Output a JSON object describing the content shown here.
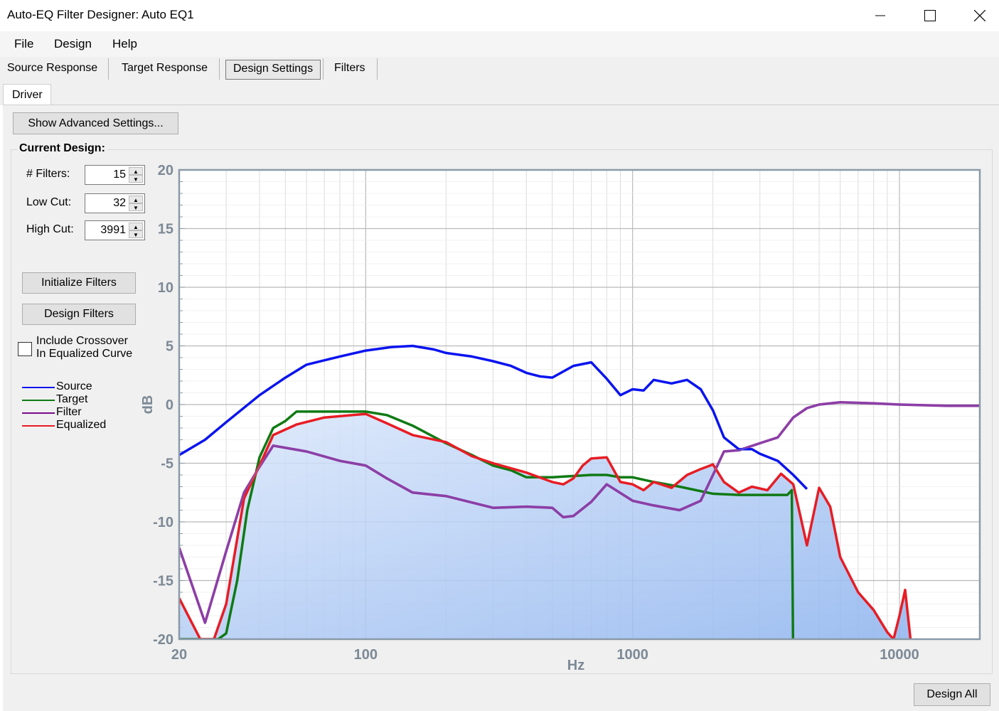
{
  "window": {
    "title": "Auto-EQ Filter Designer: Auto EQ1"
  },
  "menu": [
    "File",
    "Design",
    "Help"
  ],
  "toolbar": {
    "source_response": "Source Response",
    "target_response": "Target Response",
    "design_settings": "Design Settings",
    "filters": "Filters"
  },
  "tabs": {
    "driver": "Driver"
  },
  "buttons": {
    "advanced": "Show Advanced Settings...",
    "initialize": "Initialize Filters",
    "design_filters": "Design Filters",
    "design_all": "Design All"
  },
  "current_design": {
    "label": "Current Design:",
    "filters_label": "# Filters:",
    "filters_value": "15",
    "low_cut_label": "Low Cut:",
    "low_cut_value": "32",
    "high_cut_label": "High Cut:",
    "high_cut_value": "3991"
  },
  "include_crossover": {
    "line1": "Include Crossover",
    "line2": "In Equalized Curve",
    "checked": false
  },
  "colors": {
    "source": "#0a14ef",
    "target": "#0f7a14",
    "filter": "#7a0a8a",
    "equalized": "#e81c24",
    "fill": "#8db3ee",
    "filter_over_fill": "#9b6dc0",
    "target_over_fill": "#4e8a80"
  },
  "chart_data": {
    "type": "line",
    "x_scale": "log",
    "xlim": [
      20,
      20000
    ],
    "ylim": [
      -20,
      20
    ],
    "xlabel": "Hz",
    "ylabel": "dB",
    "x_ticks": [
      "20",
      "100",
      "1000",
      "10000"
    ],
    "y_ticks": [
      "20",
      "15",
      "10",
      "5",
      "0",
      "-5",
      "-10",
      "-15",
      "-20"
    ],
    "grid": true,
    "legend_position": "left-outside",
    "series": [
      {
        "name": "Source",
        "color": "#0a14ef",
        "points": [
          [
            20,
            -4.3
          ],
          [
            25,
            -3
          ],
          [
            30,
            -1.5
          ],
          [
            40,
            0.8
          ],
          [
            50,
            2.3
          ],
          [
            60,
            3.4
          ],
          [
            80,
            4.1
          ],
          [
            100,
            4.6
          ],
          [
            125,
            4.9
          ],
          [
            150,
            5
          ],
          [
            180,
            4.7
          ],
          [
            200,
            4.4
          ],
          [
            250,
            4.1
          ],
          [
            300,
            3.7
          ],
          [
            350,
            3.3
          ],
          [
            400,
            2.7
          ],
          [
            450,
            2.4
          ],
          [
            500,
            2.3
          ],
          [
            600,
            3.3
          ],
          [
            700,
            3.6
          ],
          [
            800,
            2.2
          ],
          [
            900,
            0.8
          ],
          [
            1000,
            1.3
          ],
          [
            1100,
            1.2
          ],
          [
            1200,
            2.1
          ],
          [
            1400,
            1.8
          ],
          [
            1600,
            2.1
          ],
          [
            1800,
            1.3
          ],
          [
            2000,
            -0.5
          ],
          [
            2200,
            -2.8
          ],
          [
            2500,
            -3.8
          ],
          [
            2800,
            -3.8
          ],
          [
            3000,
            -4.2
          ],
          [
            3500,
            -4.8
          ],
          [
            4000,
            -6
          ],
          [
            4500,
            -7.2
          ]
        ]
      },
      {
        "name": "Target",
        "color": "#0f7a14",
        "points": [
          [
            20,
            -20
          ],
          [
            28,
            -20
          ],
          [
            30,
            -19.5
          ],
          [
            33,
            -15
          ],
          [
            36,
            -9
          ],
          [
            40,
            -4.5
          ],
          [
            45,
            -2
          ],
          [
            50,
            -1.4
          ],
          [
            55,
            -0.6
          ],
          [
            70,
            -0.6
          ],
          [
            80,
            -0.6
          ],
          [
            100,
            -0.6
          ],
          [
            120,
            -0.9
          ],
          [
            150,
            -1.8
          ],
          [
            200,
            -3.3
          ],
          [
            250,
            -4.3
          ],
          [
            300,
            -5.2
          ],
          [
            350,
            -5.6
          ],
          [
            400,
            -6.2
          ],
          [
            500,
            -6.2
          ],
          [
            700,
            -6
          ],
          [
            800,
            -6
          ],
          [
            900,
            -6.2
          ],
          [
            1000,
            -6.2
          ],
          [
            1200,
            -6.6
          ],
          [
            1500,
            -7
          ],
          [
            2000,
            -7.6
          ],
          [
            2500,
            -7.7
          ],
          [
            3000,
            -7.7
          ],
          [
            3500,
            -7.7
          ],
          [
            3800,
            -7.7
          ],
          [
            3950,
            -7.3
          ],
          [
            3991,
            -20
          ]
        ]
      },
      {
        "name": "Filter",
        "color": "#7a0a8a",
        "points": [
          [
            20,
            -12.2
          ],
          [
            25,
            -18.6
          ],
          [
            30,
            -12.5
          ],
          [
            35,
            -7.5
          ],
          [
            40,
            -5.3
          ],
          [
            45,
            -3.5
          ],
          [
            60,
            -4
          ],
          [
            80,
            -4.8
          ],
          [
            100,
            -5.2
          ],
          [
            120,
            -6.3
          ],
          [
            150,
            -7.5
          ],
          [
            200,
            -7.8
          ],
          [
            300,
            -8.8
          ],
          [
            400,
            -8.7
          ],
          [
            500,
            -8.8
          ],
          [
            550,
            -9.6
          ],
          [
            600,
            -9.5
          ],
          [
            700,
            -8.3
          ],
          [
            800,
            -6.8
          ],
          [
            1000,
            -8.2
          ],
          [
            1200,
            -8.6
          ],
          [
            1500,
            -9
          ],
          [
            1800,
            -8.2
          ],
          [
            2000,
            -6
          ],
          [
            2200,
            -4
          ],
          [
            2500,
            -3.9
          ],
          [
            3000,
            -3.3
          ],
          [
            3500,
            -2.8
          ],
          [
            4000,
            -1.1
          ],
          [
            4500,
            -0.3
          ],
          [
            5000,
            0
          ],
          [
            6000,
            0.2
          ],
          [
            8000,
            0.1
          ],
          [
            10000,
            0
          ],
          [
            15000,
            -0.1
          ],
          [
            20000,
            -0.1
          ]
        ]
      },
      {
        "name": "Equalized",
        "color": "#e81c24",
        "points": [
          [
            20,
            -16.5
          ],
          [
            24,
            -20
          ],
          [
            27,
            -20
          ],
          [
            30,
            -17
          ],
          [
            35,
            -8
          ],
          [
            40,
            -5.2
          ],
          [
            45,
            -2.6
          ],
          [
            55,
            -1.7
          ],
          [
            70,
            -1.1
          ],
          [
            100,
            -0.8
          ],
          [
            120,
            -1.6
          ],
          [
            150,
            -2.6
          ],
          [
            200,
            -3.2
          ],
          [
            250,
            -4.4
          ],
          [
            300,
            -5
          ],
          [
            400,
            -5.8
          ],
          [
            500,
            -6.6
          ],
          [
            550,
            -6.8
          ],
          [
            600,
            -6.3
          ],
          [
            650,
            -5.2
          ],
          [
            700,
            -4.6
          ],
          [
            800,
            -4.5
          ],
          [
            900,
            -6.6
          ],
          [
            1000,
            -6.8
          ],
          [
            1100,
            -7.3
          ],
          [
            1200,
            -6.6
          ],
          [
            1400,
            -7.1
          ],
          [
            1600,
            -6
          ],
          [
            1800,
            -5.5
          ],
          [
            2000,
            -5.1
          ],
          [
            2200,
            -6.6
          ],
          [
            2500,
            -7.5
          ],
          [
            2800,
            -7
          ],
          [
            3200,
            -7.3
          ],
          [
            3600,
            -5.9
          ],
          [
            4000,
            -6.8
          ],
          [
            4500,
            -12
          ],
          [
            5000,
            -7.1
          ],
          [
            5500,
            -8.7
          ],
          [
            6000,
            -13
          ],
          [
            7000,
            -16
          ],
          [
            8000,
            -17.5
          ],
          [
            9000,
            -19.4
          ],
          [
            9500,
            -20
          ],
          [
            10000,
            -18
          ],
          [
            10500,
            -15.8
          ],
          [
            11000,
            -20
          ]
        ]
      }
    ]
  }
}
